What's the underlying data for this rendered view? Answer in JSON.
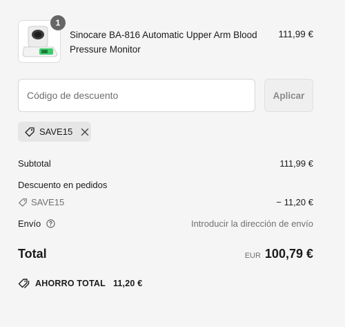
{
  "cart": {
    "item": {
      "quantity": "1",
      "name": "Sinocare BA-816 Automatic Upper Arm Blood Pressure Monitor",
      "price": "111,99 €"
    }
  },
  "discount": {
    "placeholder": "Código de descuento",
    "apply_label": "Aplicar",
    "applied_code": "SAVE15"
  },
  "summary": {
    "subtotal_label": "Subtotal",
    "subtotal_value": "111,99 €",
    "order_discount_label": "Descuento en pedidos",
    "order_discount_code": "SAVE15",
    "order_discount_value": "− 11,20 €",
    "shipping_label": "Envío",
    "shipping_value": "Introducir la dirección de envío",
    "total_label": "Total",
    "total_currency": "EUR",
    "total_value": "100,79 €",
    "savings_label": "AHORRO TOTAL",
    "savings_value": "11,20 €"
  },
  "colors": {
    "background": "#f5f5f5",
    "badge": "#666666",
    "chip": "#e6e6e6",
    "muted_text": "#707070",
    "device_green": "#3ecb6a"
  },
  "icons": {
    "chip_tag": "tag-icon",
    "chip_remove": "close-icon",
    "discount_tag": "tag-icon",
    "shipping_help": "question-circle-icon",
    "savings": "tags-icon"
  }
}
